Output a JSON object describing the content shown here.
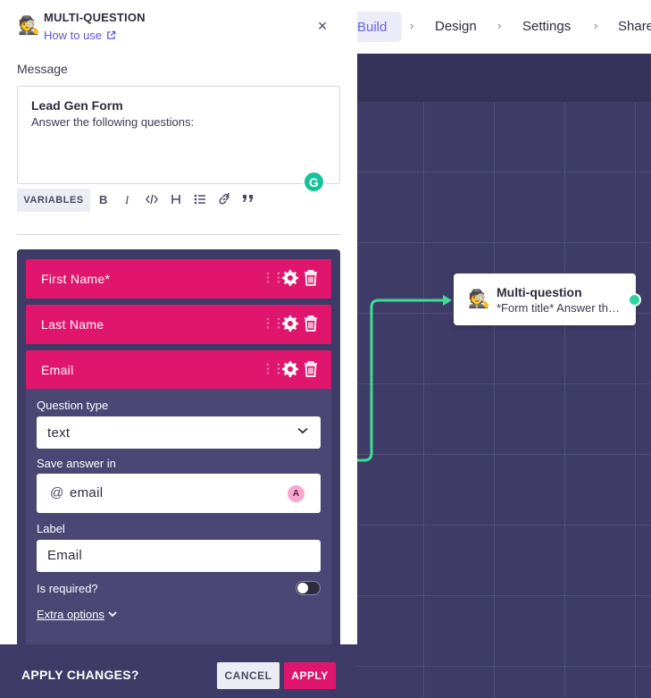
{
  "nav": {
    "active": "Build",
    "items": [
      "Design",
      "Settings",
      "Share"
    ],
    "separator": "›"
  },
  "panel": {
    "icon": "🕵",
    "title": "MULTI-QUESTION",
    "how_to_use": "How to use",
    "close": "×",
    "message_label": "Message",
    "editor": {
      "title": "Lead Gen Form",
      "body": "Answer the following questions:"
    },
    "grammarly_badge": "G",
    "toolbar": {
      "variables": "VARIABLES",
      "bold": "B",
      "italic": "I"
    },
    "questions": [
      {
        "label": "First Name*"
      },
      {
        "label": "Last Name"
      },
      {
        "label": "Email"
      }
    ],
    "detail": {
      "question_type_label": "Question type",
      "question_type_value": "text",
      "save_answer_label": "Save answer in",
      "save_answer_prefix": "@",
      "save_answer_value": "email",
      "save_answer_badge": "A",
      "label_label": "Label",
      "label_value": "Email",
      "required_label": "Is required?",
      "required": false,
      "extra_options": "Extra options"
    },
    "apply_bar": {
      "prompt": "APPLY CHANGES?",
      "cancel": "CANCEL",
      "apply": "APPLY"
    }
  },
  "canvas": {
    "node": {
      "icon": "🕵",
      "title": "Multi-question",
      "subtitle": "*Form title* Answer the following questions:"
    },
    "colors": {
      "accent": "#e0166e",
      "connector": "#3ddc97",
      "background": "#3e3c66"
    }
  }
}
